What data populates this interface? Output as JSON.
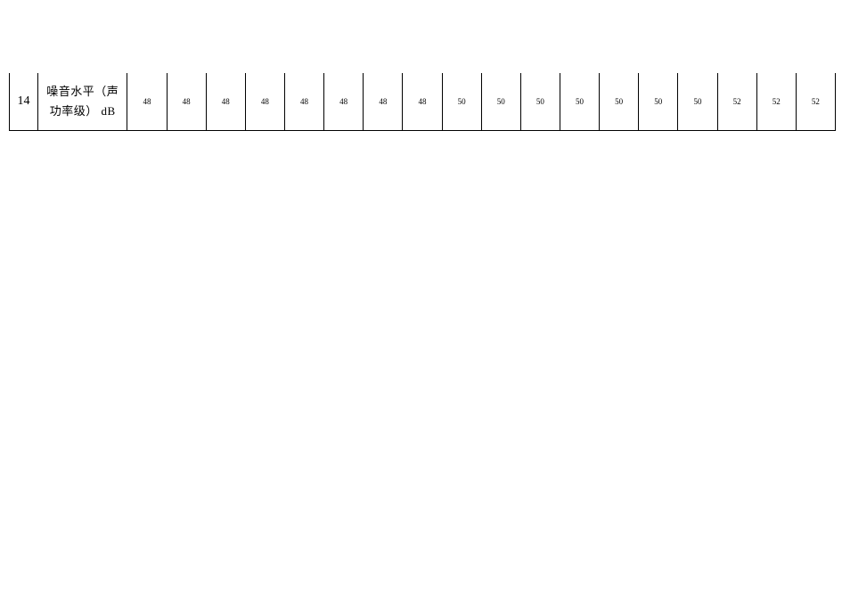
{
  "row": {
    "index": "14",
    "label_line1": "噪音水平（声",
    "label_line2": "功率级）  dB",
    "values": [
      "48",
      "48",
      "48",
      "48",
      "48",
      "48",
      "48",
      "48",
      "50",
      "50",
      "50",
      "50",
      "50",
      "50",
      "50",
      "52",
      "52",
      "52"
    ]
  }
}
